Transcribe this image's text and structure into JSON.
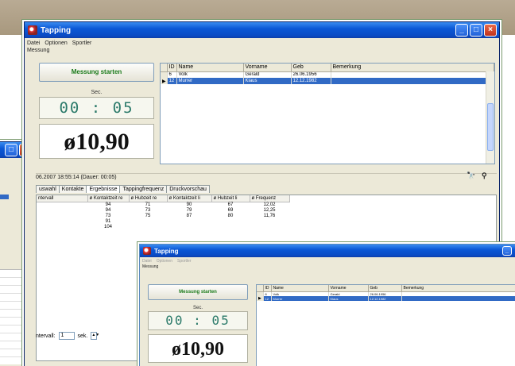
{
  "app": {
    "title": "Tapping"
  },
  "menu": {
    "items": [
      "Datei",
      "Optionen",
      "Sportler"
    ],
    "sub": "Messung"
  },
  "measure": {
    "start_label": "Messung starten",
    "sec_label": "Sec.",
    "time": "00 : 05",
    "value": "ø10,90"
  },
  "table": {
    "columns": [
      "ID",
      "Name",
      "Vorname",
      "Geb",
      "Bemerkung"
    ],
    "rows": [
      {
        "id": "6",
        "name": "Volk",
        "vorname": "Gerald",
        "geb": "26.06.1956",
        "bem": ""
      },
      {
        "id": "12",
        "name": "Murrer",
        "vorname": "Klaus",
        "geb": "12.12.1982",
        "bem": ""
      }
    ]
  },
  "status": {
    "text": "06.2007 18:55:14  (Dauer: 00:05)"
  },
  "tabs": [
    "uswahl",
    "Kontakte",
    "Ergebnisse",
    "Tappingfrequenz",
    "Druckvorschau"
  ],
  "results": {
    "columns": [
      "ntervall",
      "ø Kontaktzeit re",
      "ø Hubzeit re",
      "ø Kontaktzeit li",
      "ø Hubzeit li",
      "ø Frequenz"
    ],
    "rows": [
      [
        "",
        "94",
        "71",
        "90",
        "67",
        "12,02"
      ],
      [
        "",
        "94",
        "73",
        "79",
        "69",
        "12,25"
      ],
      [
        "",
        "73",
        "75",
        "87",
        "80",
        "11,76"
      ],
      [
        "",
        "91",
        "",
        "",
        "",
        ""
      ],
      [
        "",
        "104",
        "",
        "",
        "",
        ""
      ]
    ]
  },
  "footer": {
    "label": "ntervall:",
    "value": "1",
    "unit": "sek."
  },
  "icons": {
    "minimize": "_",
    "maximize": "□",
    "close": "×"
  }
}
